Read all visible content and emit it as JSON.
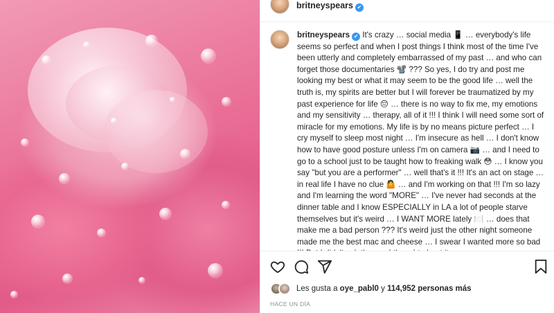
{
  "header": {
    "username": "britneyspears",
    "verified_glyph": "✔"
  },
  "caption": {
    "username": "britneyspears",
    "text": "It's crazy … social media 📱 … everybody's life seems so perfect and when I post things I think most of the time I've been utterly and completely embarrassed of my past … and who can forget those documentaries 📽️ ??? So yes, I do try and post me looking my best or what it may seem to be the good life … well the truth is, my spirits are better but I will forever be traumatized by my past experience for life 😔 … there is no way to fix me, my emotions and my sensitivity … therapy, all of it !!! I think I will need some sort of miracle for my emotions. My life is by no means picture perfect … I cry myself to sleep most night … I'm insecure as hell … I don't know how to have good posture unless I'm on camera 📷 … and I need to go to a school just to be taught how to freaking walk 😳 … I know you say \"but you are a performer\" … well that's it !!! It's an act on stage … in real life I have no clue 🤷 … and I'm working on that !!! I'm so lazy and I'm learning the word \"MORE\" … I've never had seconds at the dinner table and I know ESPECIALLY in LA a lot of people starve themselves but it's weird … I WANT MORE lately 🍽️ … does that make me a bad person ??? It's weird just the other night someone made me the best mac and cheese … I swear I wanted more so bad !!! But I didn't ask then … I thought about it"
  },
  "actions": {
    "like_icon": "heart-icon",
    "comment_icon": "comment-icon",
    "share_icon": "share-icon",
    "save_icon": "bookmark-icon"
  },
  "likes": {
    "prefix": "Les gusta a",
    "user": "oye_pabl0",
    "connector": "y",
    "count": "114,952 personas más"
  },
  "timestamp": "HACE UN DÍA",
  "colors": {
    "verified": "#3897f0",
    "text": "#262626",
    "muted": "#8e8e8e",
    "rose": "#ea7098"
  }
}
